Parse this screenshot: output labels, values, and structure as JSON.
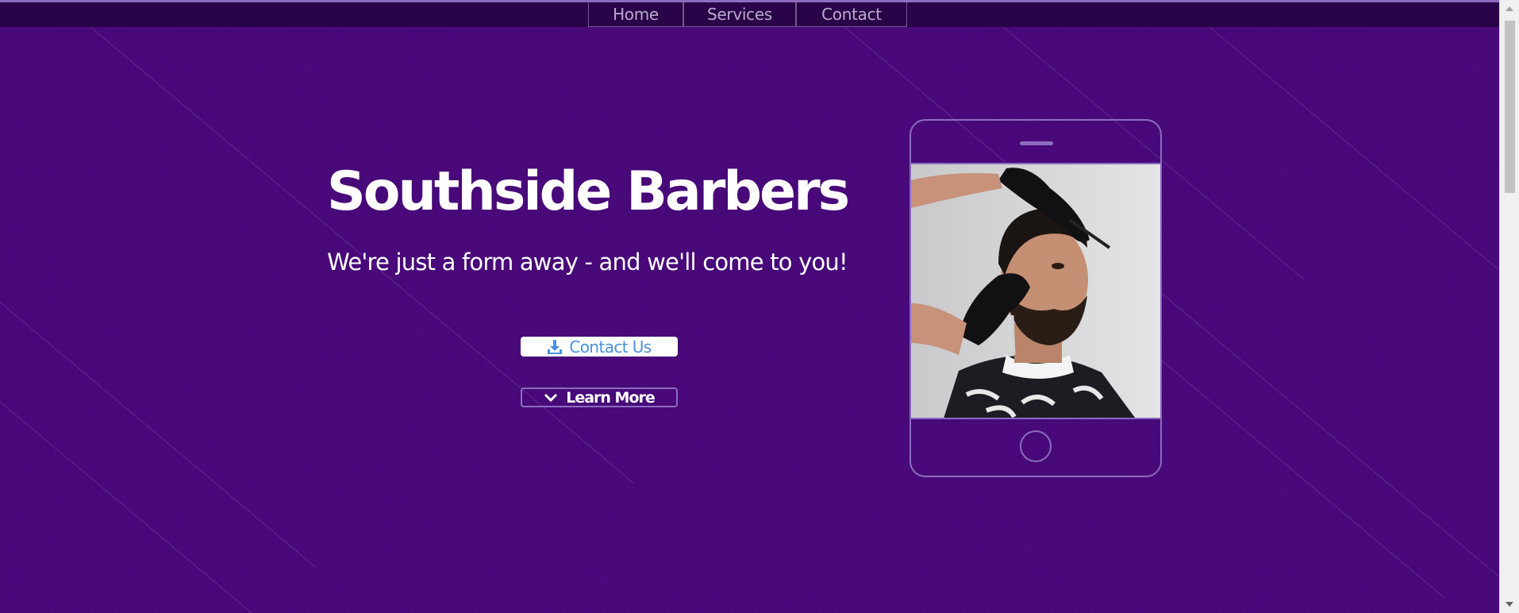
{
  "nav": {
    "items": [
      {
        "label": "Home"
      },
      {
        "label": "Services"
      },
      {
        "label": "Contact"
      }
    ]
  },
  "hero": {
    "title": "Southside Barbers",
    "subtitle": "We're just a form away - and we'll come to you!",
    "contact_button": {
      "label": "Contact Us",
      "icon": "download-icon"
    },
    "learn_button": {
      "label": "Learn More",
      "icon": "chevron-down-icon"
    }
  },
  "phone": {
    "image_description": "barber-cutting-hair-photo"
  },
  "colors": {
    "background": "#48077a",
    "topbar": "#2a0448",
    "accent": "#8c6cc0",
    "contact_text": "#4a90e2"
  }
}
